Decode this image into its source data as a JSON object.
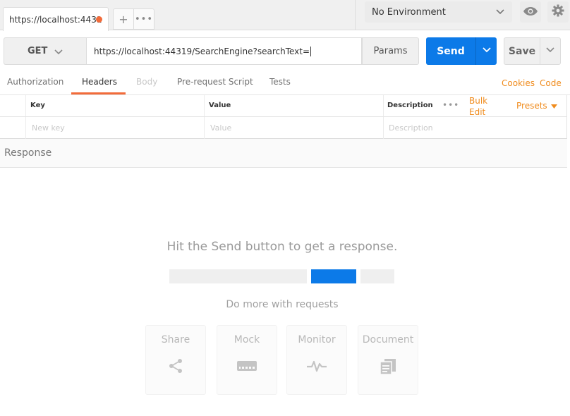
{
  "tabs": {
    "active_label": "https://localhost:4431",
    "add_label": "+",
    "more_label": "•••"
  },
  "environment": {
    "selected": "No Environment"
  },
  "request": {
    "method": "GET",
    "url": "https://localhost:44319/SearchEngine?searchText=",
    "params_label": "Params",
    "send_label": "Send",
    "save_label": "Save"
  },
  "request_tabs": {
    "authorization": "Authorization",
    "headers": "Headers",
    "body": "Body",
    "pre_request": "Pre-request Script",
    "tests": "Tests",
    "cookies": "Cookies",
    "code": "Code"
  },
  "headers_table": {
    "columns": {
      "key": "Key",
      "value": "Value",
      "description": "Description"
    },
    "placeholders": {
      "key": "New key",
      "value": "Value",
      "description": "Description"
    },
    "more_label": "•••",
    "bulk_edit_1": "Bulk",
    "bulk_edit_2": "Edit",
    "presets": "Presets"
  },
  "response": {
    "title": "Response",
    "empty_message": "Hit the Send button to get a response.",
    "more_title": "Do more with requests",
    "cards": [
      "Share",
      "Mock",
      "Monitor",
      "Document"
    ]
  },
  "colors": {
    "accent_orange": "#f26b3a",
    "link_orange": "#f08c1e",
    "send_blue": "#0c7ae8"
  },
  "icons": [
    "eye-icon",
    "gear-icon",
    "chevron-down-icon",
    "share-icon",
    "mock-server-icon",
    "monitor-pulse-icon",
    "document-icon"
  ]
}
